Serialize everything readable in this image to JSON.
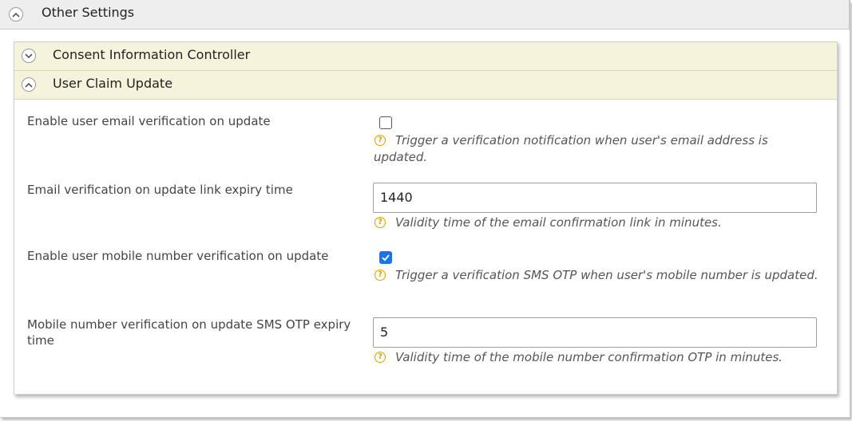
{
  "outer_section": {
    "title": "Other Settings",
    "expanded": true
  },
  "subsections": [
    {
      "title": "Consent Information Controller",
      "expanded": false
    },
    {
      "title": "User Claim Update",
      "expanded": true
    }
  ],
  "fields": {
    "email_verify": {
      "label": "Enable user email verification on update",
      "checked": false,
      "help": "Trigger a verification notification when user's email address is updated."
    },
    "email_expiry": {
      "label": "Email verification on update link expiry time",
      "value": "1440",
      "help": "Validity time of the email confirmation link in minutes."
    },
    "mobile_verify": {
      "label": "Enable user mobile number verification on update",
      "checked": true,
      "help": "Trigger a verification SMS OTP when user's mobile number is updated."
    },
    "mobile_expiry": {
      "label": "Mobile number verification on update SMS OTP expiry time",
      "value": "5",
      "help": "Validity time of the mobile number confirmation OTP in minutes."
    }
  },
  "icons": {
    "help": "question-circle-icon",
    "collapse": "chevron-up-icon",
    "expand": "chevron-down-icon"
  },
  "colors": {
    "subheader_bg": "#f6f3dc",
    "checkbox_checked": "#1a73e8",
    "help_icon": "#d9a400"
  }
}
